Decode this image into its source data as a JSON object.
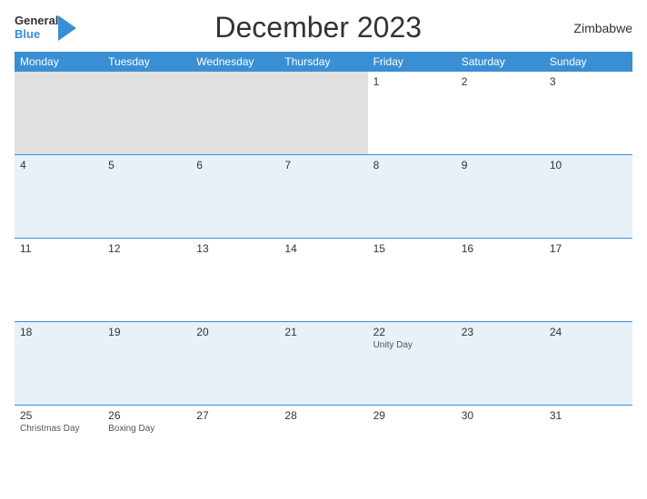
{
  "header": {
    "title": "December 2023",
    "country": "Zimbabwe",
    "logo_general": "General",
    "logo_blue": "Blue"
  },
  "days_of_week": [
    "Monday",
    "Tuesday",
    "Wednesday",
    "Thursday",
    "Friday",
    "Saturday",
    "Sunday"
  ],
  "weeks": [
    [
      {
        "date": "",
        "holiday": "",
        "empty": true
      },
      {
        "date": "",
        "holiday": "",
        "empty": true
      },
      {
        "date": "",
        "holiday": "",
        "empty": true
      },
      {
        "date": "",
        "holiday": "",
        "empty": true
      },
      {
        "date": "1",
        "holiday": ""
      },
      {
        "date": "2",
        "holiday": ""
      },
      {
        "date": "3",
        "holiday": ""
      }
    ],
    [
      {
        "date": "4",
        "holiday": ""
      },
      {
        "date": "5",
        "holiday": ""
      },
      {
        "date": "6",
        "holiday": ""
      },
      {
        "date": "7",
        "holiday": ""
      },
      {
        "date": "8",
        "holiday": ""
      },
      {
        "date": "9",
        "holiday": ""
      },
      {
        "date": "10",
        "holiday": ""
      }
    ],
    [
      {
        "date": "11",
        "holiday": ""
      },
      {
        "date": "12",
        "holiday": ""
      },
      {
        "date": "13",
        "holiday": ""
      },
      {
        "date": "14",
        "holiday": ""
      },
      {
        "date": "15",
        "holiday": ""
      },
      {
        "date": "16",
        "holiday": ""
      },
      {
        "date": "17",
        "holiday": ""
      }
    ],
    [
      {
        "date": "18",
        "holiday": ""
      },
      {
        "date": "19",
        "holiday": ""
      },
      {
        "date": "20",
        "holiday": ""
      },
      {
        "date": "21",
        "holiday": ""
      },
      {
        "date": "22",
        "holiday": "Unity Day"
      },
      {
        "date": "23",
        "holiday": ""
      },
      {
        "date": "24",
        "holiday": ""
      }
    ],
    [
      {
        "date": "25",
        "holiday": "Christmas Day"
      },
      {
        "date": "26",
        "holiday": "Boxing Day"
      },
      {
        "date": "27",
        "holiday": ""
      },
      {
        "date": "28",
        "holiday": ""
      },
      {
        "date": "29",
        "holiday": ""
      },
      {
        "date": "30",
        "holiday": ""
      },
      {
        "date": "31",
        "holiday": ""
      }
    ]
  ]
}
